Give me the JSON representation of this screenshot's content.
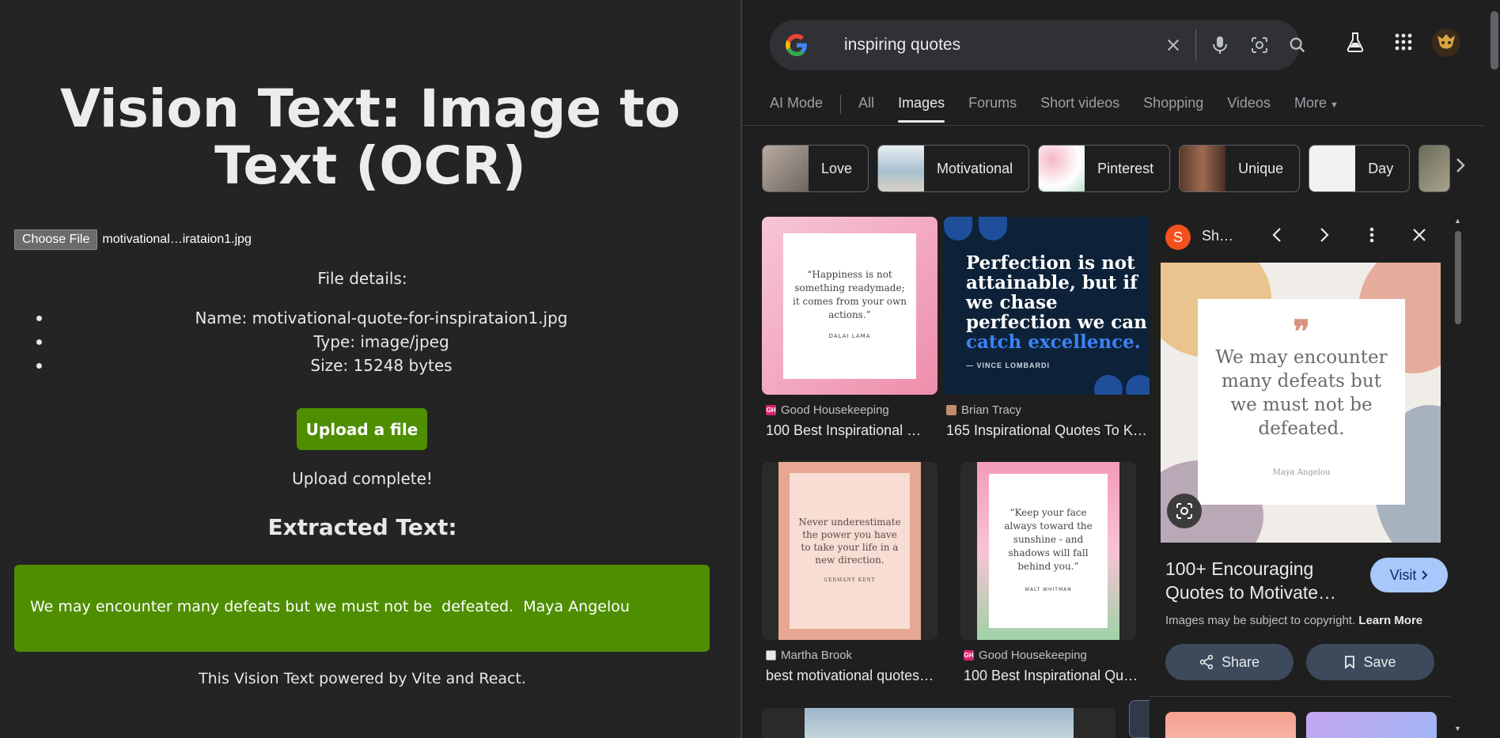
{
  "app": {
    "title": "Vision Text: Image to Text (OCR)",
    "choose_file_label": "Choose File",
    "chosen_file_display": "motivational…irataion1.jpg",
    "file_details_heading": "File details:",
    "details": [
      "Name: motivational-quote-for-inspirataion1.jpg",
      "Type: image/jpeg",
      "Size: 15248 bytes"
    ],
    "upload_button": "Upload a file",
    "upload_status": "Upload complete!",
    "extracted_heading": "Extracted Text:",
    "extracted_text": "We may encounter many defeats but we must not be  defeated.  Maya Angelou",
    "footer": "This Vision Text powered by Vite and React.",
    "accent_color": "#4e8e00"
  },
  "google": {
    "search_query": "inspiring quotes",
    "tabs": [
      "AI Mode",
      "All",
      "Images",
      "Forums",
      "Short videos",
      "Shopping",
      "Videos",
      "More"
    ],
    "active_tab": "Images",
    "chips": [
      "Love",
      "Motivational",
      "Pinterest",
      "Unique",
      "Day"
    ],
    "results": [
      {
        "source": "Good Housekeeping",
        "title": "100 Best Inspirational …",
        "quote": "“Happiness is not something readymade; it comes from your own actions.”",
        "author": "DALAI LAMA"
      },
      {
        "source": "Brian Tracy",
        "title": "165 Inspirational Quotes To Ke…",
        "quote_a": "Perfection is not attainable, but if we chase perfection we can",
        "quote_b": "catch excellence.",
        "author": "— VINCE LOMBARDI"
      },
      {
        "source": "Martha Brook",
        "title": "best motivational quotes …",
        "quote": "Never underestimate the power you have to take your life in a new direction.",
        "author": "GERMANY KENT"
      },
      {
        "source": "Good Housekeeping",
        "title": "100 Best Inspirational Qu…",
        "quote": "“Keep your face always toward the sunshine - and shadows will fall behind you.”",
        "author": "WALT WHITMAN"
      }
    ],
    "panel": {
      "site": "Sh…",
      "site_initial": "S",
      "quote": "We may encounter many defeats but we must not be defeated.",
      "author": "Maya Angelou",
      "title": "100+ Encouraging Quotes to Motivate…",
      "visit_label": "Visit",
      "copyright_text": "Images may be subject to copyright.",
      "learn_more": "Learn More",
      "share_label": "Share",
      "save_label": "Save"
    }
  }
}
